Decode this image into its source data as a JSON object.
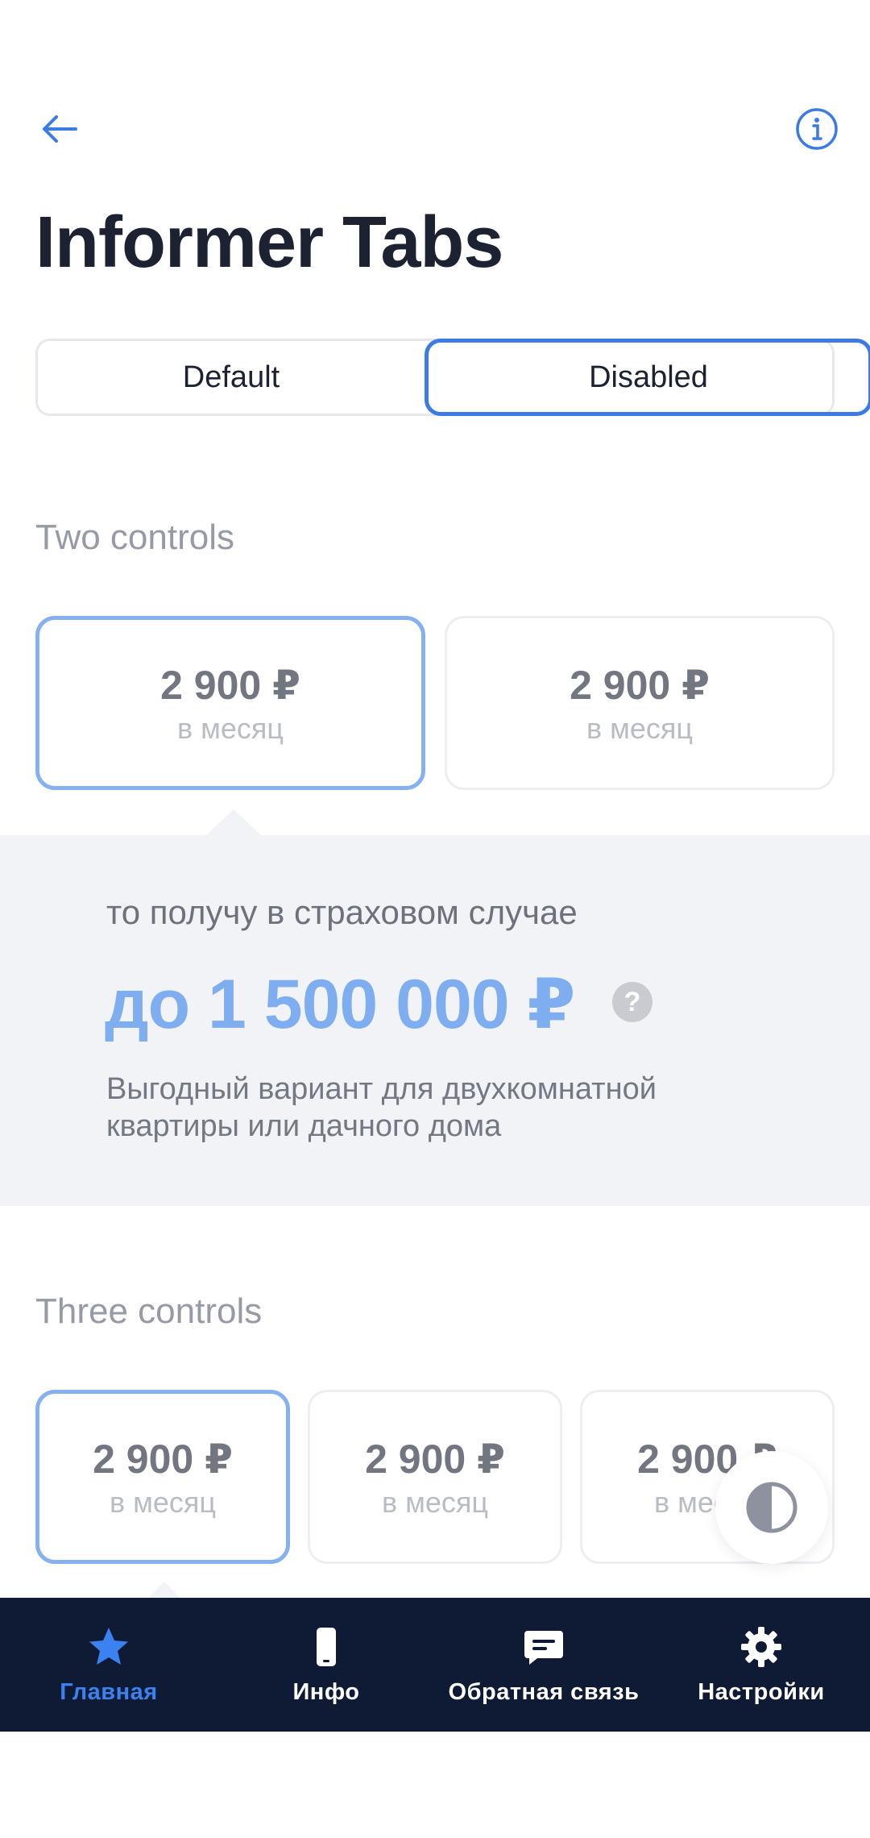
{
  "header": {
    "title": "Informer Tabs",
    "back_icon": "arrow-left-icon",
    "info_icon": "info-circle-icon"
  },
  "segmented": {
    "options": [
      {
        "label": "Default",
        "selected": false
      },
      {
        "label": "Disabled",
        "selected": true
      }
    ]
  },
  "two_controls": {
    "title": "Two controls",
    "cards": [
      {
        "price": "2 900 ₽",
        "period": "в месяц",
        "selected": true
      },
      {
        "price": "2 900 ₽",
        "period": "в месяц",
        "selected": false
      }
    ],
    "panel": {
      "caption": "то получу в страховом случае",
      "amount": "до 1 500 000 ₽",
      "help_icon": "?",
      "description": "Выгодный вариант для двухкомнатной квартиры или дачного дома"
    }
  },
  "three_controls": {
    "title": "Three controls",
    "cards": [
      {
        "price": "2 900 ₽",
        "period": "в месяц",
        "selected": true
      },
      {
        "price": "2 900 ₽",
        "period": "в месяц",
        "selected": false
      },
      {
        "price": "2 900 ₽",
        "period": "в месяц",
        "selected": false
      }
    ]
  },
  "theme_toggle_icon": "contrast-icon",
  "bottom_nav": {
    "items": [
      {
        "label": "Главная",
        "icon": "star-icon",
        "active": true
      },
      {
        "label": "Инфо",
        "icon": "phone-icon",
        "active": false
      },
      {
        "label": "Обратная связь",
        "icon": "chat-icon",
        "active": false
      },
      {
        "label": "Настройки",
        "icon": "gear-icon",
        "active": false
      }
    ]
  },
  "colors": {
    "accent": "#3b7be2",
    "selected_border": "#86b1f0",
    "amount": "#7eaef0",
    "nav_bg": "#0f1b35",
    "panel_bg": "#f2f3f7"
  }
}
